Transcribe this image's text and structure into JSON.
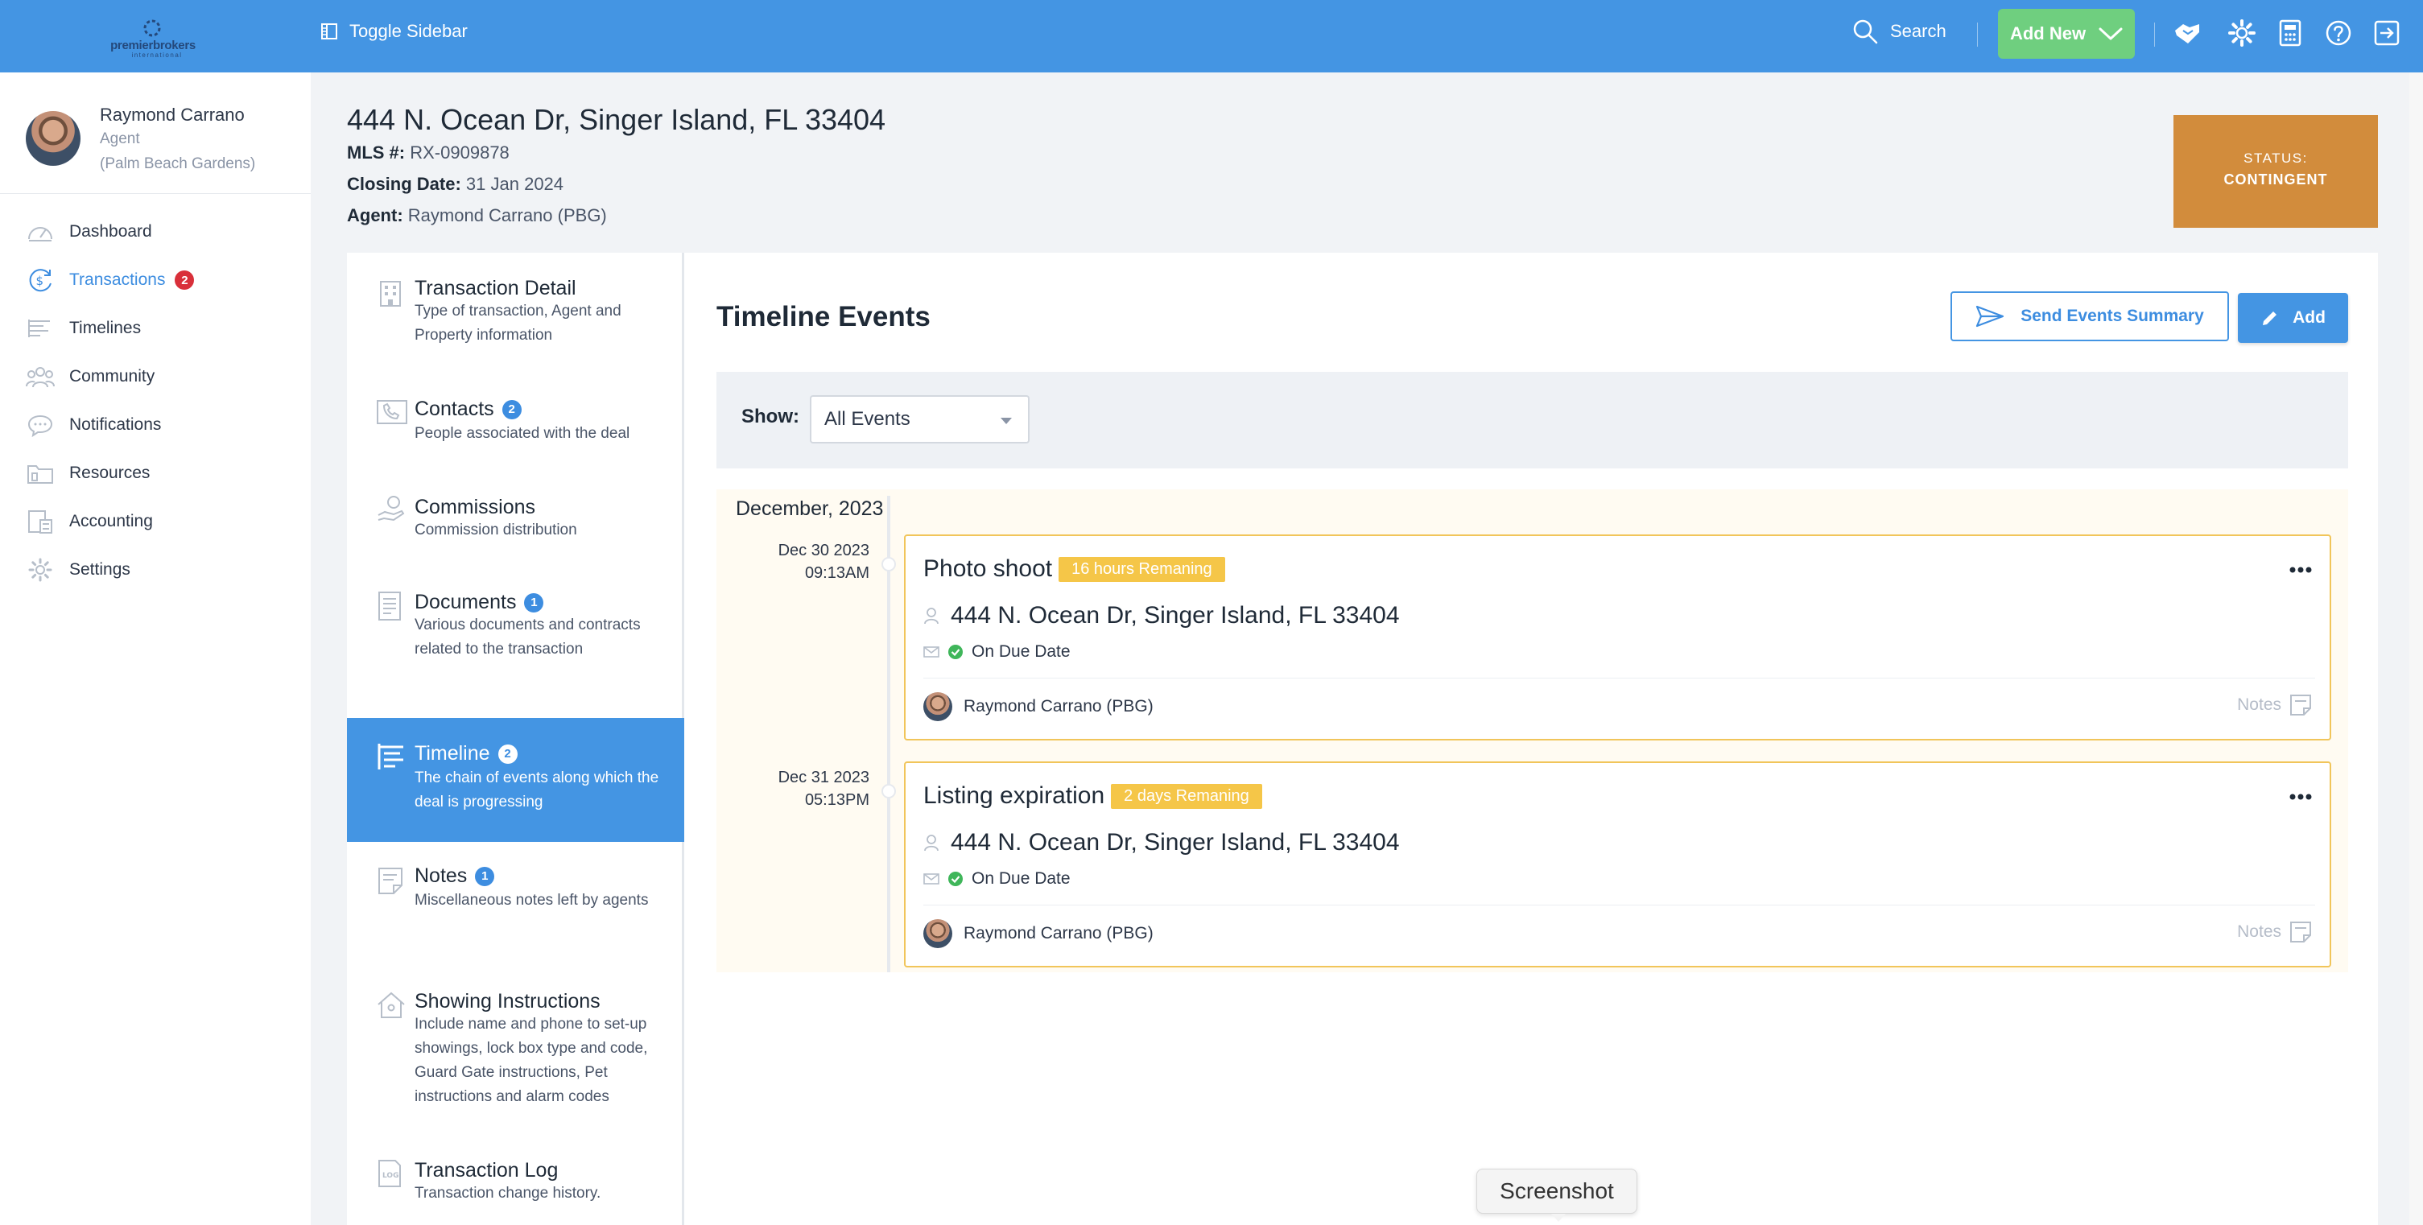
{
  "topbar": {
    "logo_line1": "premierbrokers",
    "logo_line2": "international",
    "toggle_label": "Toggle Sidebar",
    "search_label": "Search",
    "add_new_label": "Add New"
  },
  "user": {
    "name": "Raymond Carrano",
    "role": "Agent",
    "office": "(Palm Beach Gardens)"
  },
  "nav": {
    "items": [
      {
        "label": "Dashboard",
        "icon": "dashboard-gauge-icon"
      },
      {
        "label": "Transactions",
        "icon": "dollar-cycle-icon",
        "badge": "2",
        "active": true
      },
      {
        "label": "Timelines",
        "icon": "timeline-list-icon"
      },
      {
        "label": "Community",
        "icon": "people-group-icon"
      },
      {
        "label": "Notifications",
        "icon": "chat-bubble-icon"
      },
      {
        "label": "Resources",
        "icon": "folder-icon"
      },
      {
        "label": "Accounting",
        "icon": "calculator-doc-icon"
      },
      {
        "label": "Settings",
        "icon": "gear-icon"
      }
    ]
  },
  "property": {
    "address": "444 N. Ocean Dr, Singer Island, FL 33404",
    "mls_label": "MLS #:",
    "mls_value": "RX-0909878",
    "closing_label": "Closing Date:",
    "closing_value": "31 Jan 2024",
    "agent_label": "Agent:",
    "agent_value": "Raymond Carrano (PBG)"
  },
  "status": {
    "label": "STATUS:",
    "value": "CONTINGENT",
    "color": "#d28c3c"
  },
  "subnav": [
    {
      "title": "Transaction Detail",
      "desc": "Type of transaction, Agent and Property information"
    },
    {
      "title": "Contacts",
      "badge": "2",
      "desc": "People associated with the deal"
    },
    {
      "title": "Commissions",
      "desc": "Commission distribution"
    },
    {
      "title": "Documents",
      "badge": "1",
      "desc": "Various documents and contracts related to the transaction"
    },
    {
      "title": "Timeline",
      "badge": "2",
      "desc": "The chain of events along which the deal is progressing"
    },
    {
      "title": "Notes",
      "badge": "1",
      "desc": "Miscellaneous notes left by agents"
    },
    {
      "title": "Showing Instructions",
      "desc": "Include name and phone to set-up showings, lock box type and code, Guard Gate instructions, Pet instructions and alarm codes"
    },
    {
      "title": "Transaction Log",
      "desc": "Transaction change history."
    }
  ],
  "timeline": {
    "title": "Timeline Events",
    "send_summary_label": "Send Events Summary",
    "add_label": "Add",
    "show_label": "Show:",
    "filter_value": "All Events",
    "month": "December, 2023",
    "events": [
      {
        "date": "Dec 30 2023",
        "time": "09:13AM",
        "name": "Photo shoot",
        "remaining": "16 hours Remaning",
        "address": "444 N. Ocean Dr, Singer Island, FL 33404",
        "due": "On Due Date",
        "agent": "Raymond Carrano (PBG)",
        "notes_label": "Notes"
      },
      {
        "date": "Dec 31 2023",
        "time": "05:13PM",
        "name": "Listing expiration",
        "remaining": "2 days Remaning",
        "address": "444 N. Ocean Dr, Singer Island, FL 33404",
        "due": "On Due Date",
        "agent": "Raymond Carrano (PBG)",
        "notes_label": "Notes"
      }
    ]
  },
  "tooltip": {
    "label": "Screenshot"
  },
  "colors": {
    "accent": "#4495e3",
    "add_new": "#6fcf7f",
    "event_border": "#f1c55a",
    "remaining_badge": "#f5c648",
    "due_check": "#3fb65a",
    "nav_badge": "#d9303a"
  }
}
